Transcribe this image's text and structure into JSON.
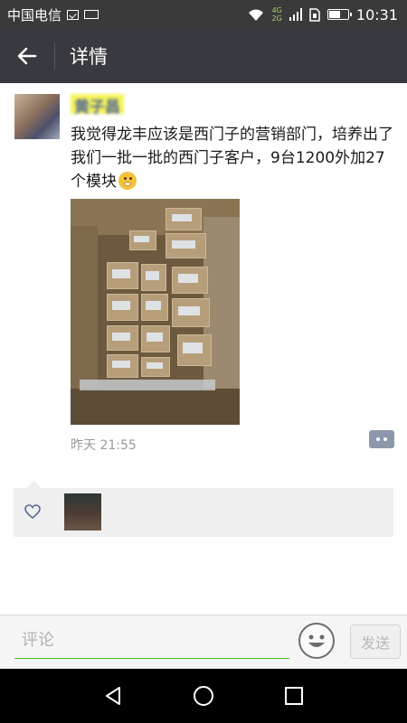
{
  "status_bar": {
    "carrier": "中国电信",
    "network_top": "4G",
    "network_bottom": "2G",
    "battery_level": 0.7,
    "time": "10:31"
  },
  "header": {
    "title": "详情",
    "back_icon": "arrow-left-icon"
  },
  "post": {
    "author_name": "黄子昌",
    "text": "我觉得龙丰应该是西门子的营销部门，培养出了我们一批一批的西门子客户，9台1200外加27个模块",
    "emoji": "shy-smile-emoji",
    "time": "昨天 21:55"
  },
  "likes": {
    "icon": "heart-icon",
    "count": 1
  },
  "comment_bar": {
    "placeholder": "评论",
    "emoji_icon": "smiley-icon",
    "send_label": "发送"
  },
  "nav_bar": {
    "back_icon": "triangle-back-icon",
    "home_icon": "circle-home-icon",
    "recents_icon": "square-recents-icon"
  },
  "colors": {
    "title_bar": "#393a3f",
    "status_bar": "#3a3a3a",
    "link_blue": "#576b95",
    "accent_green": "#45c01a"
  }
}
